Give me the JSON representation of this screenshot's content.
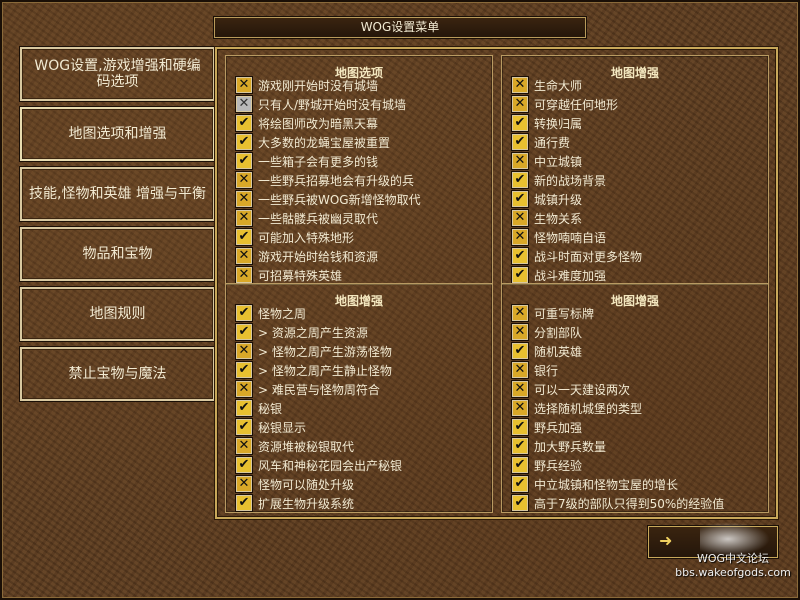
{
  "window": {
    "title": "WOG设置菜单"
  },
  "nav": [
    {
      "label": "WOG设置,游戏增强和硬编码选项"
    },
    {
      "label": "地图选项和增强"
    },
    {
      "label": "技能,怪物和英雄 增强与平衡"
    },
    {
      "label": "物品和宝物"
    },
    {
      "label": "地图规则"
    },
    {
      "label": "禁止宝物与魔法"
    }
  ],
  "panels": [
    {
      "title": "地图选项",
      "items": [
        {
          "label": "游戏刚开始时没有城墙",
          "state": "x"
        },
        {
          "label": "只有人/野城开始时没有城墙",
          "state": "gray"
        },
        {
          "label": "将绘图师改为暗黑天幕",
          "state": "check"
        },
        {
          "label": "大多数的龙蝇宝屋被重置",
          "state": "check"
        },
        {
          "label": "一些箱子会有更多的钱",
          "state": "check"
        },
        {
          "label": "一些野兵招募地会有升级的兵",
          "state": "x"
        },
        {
          "label": "一些野兵被WOG新增怪物取代",
          "state": "x"
        },
        {
          "label": "一些骷髅兵被幽灵取代",
          "state": "x"
        },
        {
          "label": "可能加入特殊地形",
          "state": "check"
        },
        {
          "label": "游戏开始时给钱和资源",
          "state": "x"
        },
        {
          "label": "可招募特殊英雄",
          "state": "x"
        }
      ]
    },
    {
      "title": "地图增强",
      "items": [
        {
          "label": "生命大师",
          "state": "x"
        },
        {
          "label": "可穿越任何地形",
          "state": "x"
        },
        {
          "label": "转换归属",
          "state": "check"
        },
        {
          "label": "通行费",
          "state": "check"
        },
        {
          "label": "中立城镇",
          "state": "x"
        },
        {
          "label": "新的战场背景",
          "state": "check"
        },
        {
          "label": "城镇升级",
          "state": "check"
        },
        {
          "label": "生物关系",
          "state": "x"
        },
        {
          "label": "怪物喃喃自语",
          "state": "x"
        },
        {
          "label": "战斗时面对更多怪物",
          "state": "check"
        },
        {
          "label": "战斗难度加强",
          "state": "check"
        }
      ]
    },
    {
      "title": "地图增强",
      "items": [
        {
          "label": "怪物之周",
          "state": "check"
        },
        {
          "label": "> 资源之周产生资源",
          "state": "check"
        },
        {
          "label": "> 怪物之周产生游荡怪物",
          "state": "x"
        },
        {
          "label": "> 怪物之周产生静止怪物",
          "state": "check"
        },
        {
          "label": "> 难民营与怪物周符合",
          "state": "x"
        },
        {
          "label": "秘银",
          "state": "check"
        },
        {
          "label": "秘银显示",
          "state": "check"
        },
        {
          "label": "资源堆被秘银取代",
          "state": "x"
        },
        {
          "label": "风车和神秘花园会出产秘银",
          "state": "check"
        },
        {
          "label": "怪物可以随处升级",
          "state": "x"
        },
        {
          "label": "扩展生物升级系统",
          "state": "check"
        }
      ]
    },
    {
      "title": "地图增强",
      "items": [
        {
          "label": "可重写标牌",
          "state": "x"
        },
        {
          "label": "分割部队",
          "state": "x"
        },
        {
          "label": "随机英雄",
          "state": "check"
        },
        {
          "label": "银行",
          "state": "x"
        },
        {
          "label": "可以一天建设两次",
          "state": "x"
        },
        {
          "label": "选择随机城堡的类型",
          "state": "x"
        },
        {
          "label": "野兵加强",
          "state": "check"
        },
        {
          "label": "加大野兵数量",
          "state": "check"
        },
        {
          "label": "野兵经验",
          "state": "check"
        },
        {
          "label": "中立城镇和怪物宝屋的增长",
          "state": "check"
        },
        {
          "label": "高于7级的部队只得到50%的经验值",
          "state": "check"
        }
      ]
    }
  ],
  "watermark": {
    "line1": "WOG中文论坛",
    "line2": "bbs.wakeofgods.com"
  },
  "glyphs": {
    "check": "✔",
    "x": "✕",
    "gray": "✕",
    "exit": "➜"
  }
}
